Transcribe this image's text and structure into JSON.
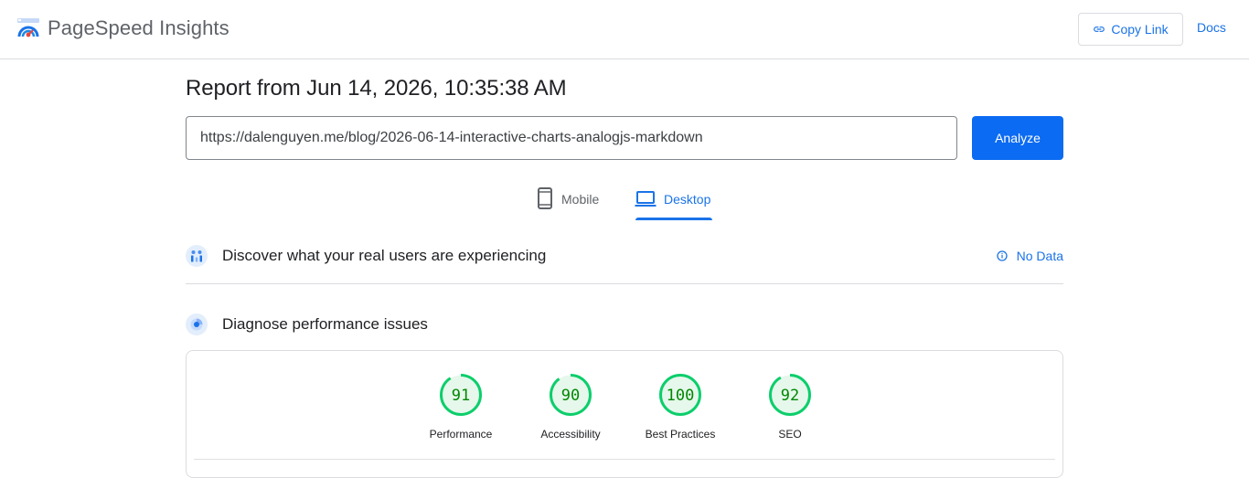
{
  "header": {
    "app_title": "PageSpeed Insights",
    "copy_link_label": "Copy Link",
    "docs_label": "Docs"
  },
  "report": {
    "title": "Report from Jun 14, 2026, 10:35:38 AM",
    "url_value": "https://dalenguyen.me/blog/2026-06-14-interactive-charts-analogjs-markdown",
    "analyze_label": "Analyze"
  },
  "tabs": [
    {
      "label": "Mobile",
      "icon": "phone-icon",
      "selected": false
    },
    {
      "label": "Desktop",
      "icon": "laptop-icon",
      "selected": true
    }
  ],
  "field_data": {
    "title": "Discover what your real users are experiencing",
    "status_label": "No Data",
    "icon": "users-chart-icon",
    "status_icon": "info-icon"
  },
  "lab_data": {
    "title": "Diagnose performance issues",
    "icon": "lighthouse-icon"
  },
  "scores": [
    {
      "label": "Performance",
      "score": "91"
    },
    {
      "label": "Accessibility",
      "score": "90"
    },
    {
      "label": "Best Practices",
      "score": "100"
    },
    {
      "label": "SEO",
      "score": "92"
    }
  ],
  "colors": {
    "accent": "#1a73e8",
    "good_score": "#0cce6b",
    "good_score_text": "#008800",
    "good_score_fill": "#e6f7ec"
  }
}
